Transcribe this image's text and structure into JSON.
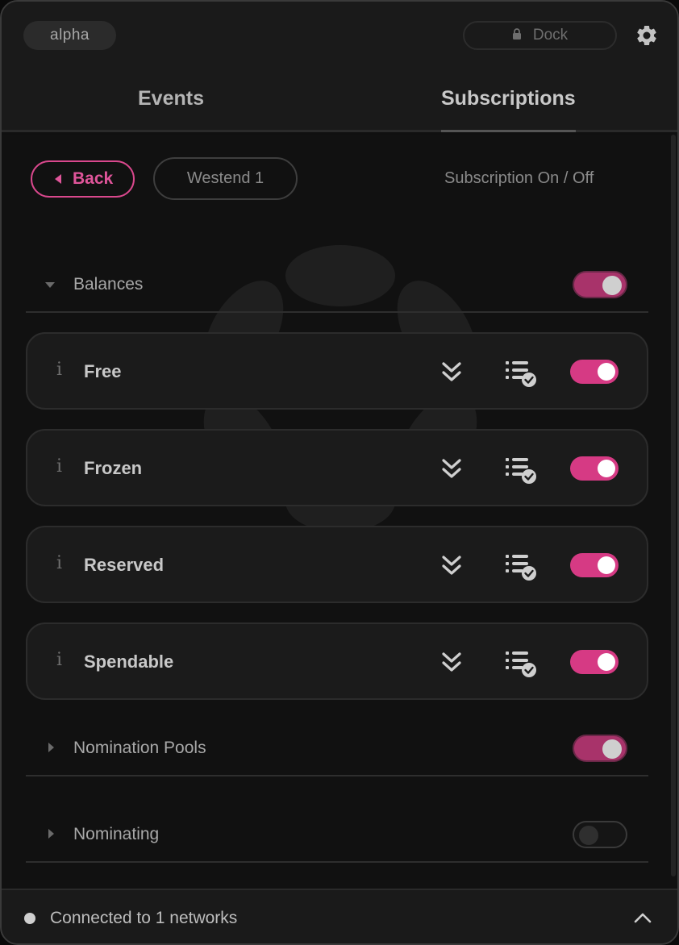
{
  "header": {
    "badge": "alpha",
    "dock_label": "Dock",
    "settings_icon": "gear-icon",
    "tabs": [
      {
        "label": "Events",
        "active": false
      },
      {
        "label": "Subscriptions",
        "active": true
      }
    ]
  },
  "subheader": {
    "back_label": "Back",
    "network_label": "Westend 1",
    "subscription_hint": "Subscription On / Off"
  },
  "categories": [
    {
      "label": "Balances",
      "expanded": true,
      "enabled": true
    },
    {
      "label": "Nomination Pools",
      "expanded": false,
      "enabled": true
    },
    {
      "label": "Nominating",
      "expanded": false,
      "enabled": false
    }
  ],
  "items": [
    {
      "info": "i",
      "label": "Free",
      "enabled": true
    },
    {
      "info": "i",
      "label": "Frozen",
      "enabled": true
    },
    {
      "info": "i",
      "label": "Reserved",
      "enabled": true
    },
    {
      "info": "i",
      "label": "Spendable",
      "enabled": true
    }
  ],
  "footer": {
    "status": "Connected to 1 networks"
  },
  "colors": {
    "accent": "#d63a84",
    "accent_muted": "#a8336a",
    "background": "#111111"
  }
}
